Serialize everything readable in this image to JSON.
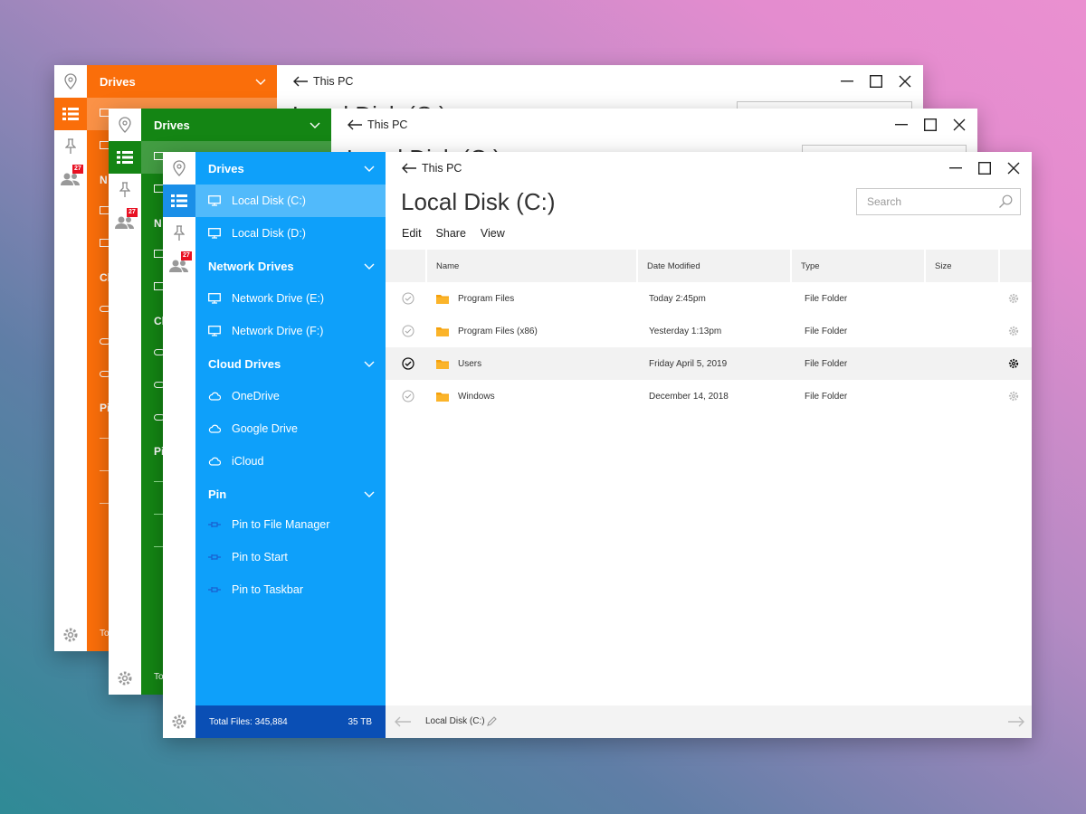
{
  "colors": {
    "orange": "#fa6e0a",
    "green": "#148514",
    "blue": "#0ea0fa",
    "blue_footer": "#0a4fb5"
  },
  "back_windows": [
    {
      "theme": "orange",
      "sidebar_heading": "Drives",
      "title": "This PC",
      "heading": "Local Disk (C:)",
      "badge": "27",
      "partial_labels": [
        "N",
        "Cl",
        "Pi",
        "To"
      ]
    },
    {
      "theme": "green",
      "sidebar_heading": "Drives",
      "title": "This PC",
      "heading": "Local Disk (C:)",
      "badge": "27",
      "partial_labels": [
        "N",
        "Cl",
        "Pi",
        "To"
      ]
    }
  ],
  "main_window": {
    "rail": {
      "icons": [
        "location-icon",
        "list-icon",
        "pin-icon",
        "people-icon",
        "gear-icon"
      ],
      "badge": "27"
    },
    "sidebar": {
      "sections": [
        {
          "label": "Drives",
          "items": [
            {
              "label": "Local Disk (C:)",
              "icon": "monitor-icon",
              "selected": true
            },
            {
              "label": "Local Disk (D:)",
              "icon": "monitor-icon"
            }
          ]
        },
        {
          "label": "Network Drives",
          "items": [
            {
              "label": "Network Drive (E:)",
              "icon": "monitor-icon"
            },
            {
              "label": "Network Drive (F:)",
              "icon": "monitor-icon"
            }
          ]
        },
        {
          "label": "Cloud Drives",
          "items": [
            {
              "label": "OneDrive",
              "icon": "cloud-icon"
            },
            {
              "label": "Google Drive",
              "icon": "cloud-icon"
            },
            {
              "label": "iCloud",
              "icon": "cloud-icon"
            }
          ]
        },
        {
          "label": "Pin",
          "items": [
            {
              "label": "Pin to File Manager",
              "icon": "pin-icon"
            },
            {
              "label": "Pin to Start",
              "icon": "pin-icon"
            },
            {
              "label": "Pin to Taskbar",
              "icon": "pin-icon"
            }
          ]
        }
      ],
      "footer": {
        "total_files": "Total Files: 345,884",
        "size": "35 TB"
      }
    },
    "titlebar": {
      "title": "This PC"
    },
    "heading": "Local Disk (C:)",
    "search": {
      "placeholder": "Search"
    },
    "menu": [
      "Edit",
      "Share",
      "View"
    ],
    "table": {
      "columns": [
        "Name",
        "Date Modified",
        "Type",
        "Size"
      ],
      "rows": [
        {
          "name": "Program Files",
          "date": "Today 2:45pm",
          "type": "File Folder",
          "checked": false
        },
        {
          "name": "Program Files (x86)",
          "date": "Yesterday 1:13pm",
          "type": "File Folder",
          "checked": false
        },
        {
          "name": "Users",
          "date": "Friday April 5, 2019",
          "type": "File Folder",
          "checked": true
        },
        {
          "name": "Windows",
          "date": "December 14, 2018",
          "type": "File Folder",
          "checked": false
        }
      ]
    },
    "status": {
      "path": "Local Disk (C:)"
    }
  }
}
